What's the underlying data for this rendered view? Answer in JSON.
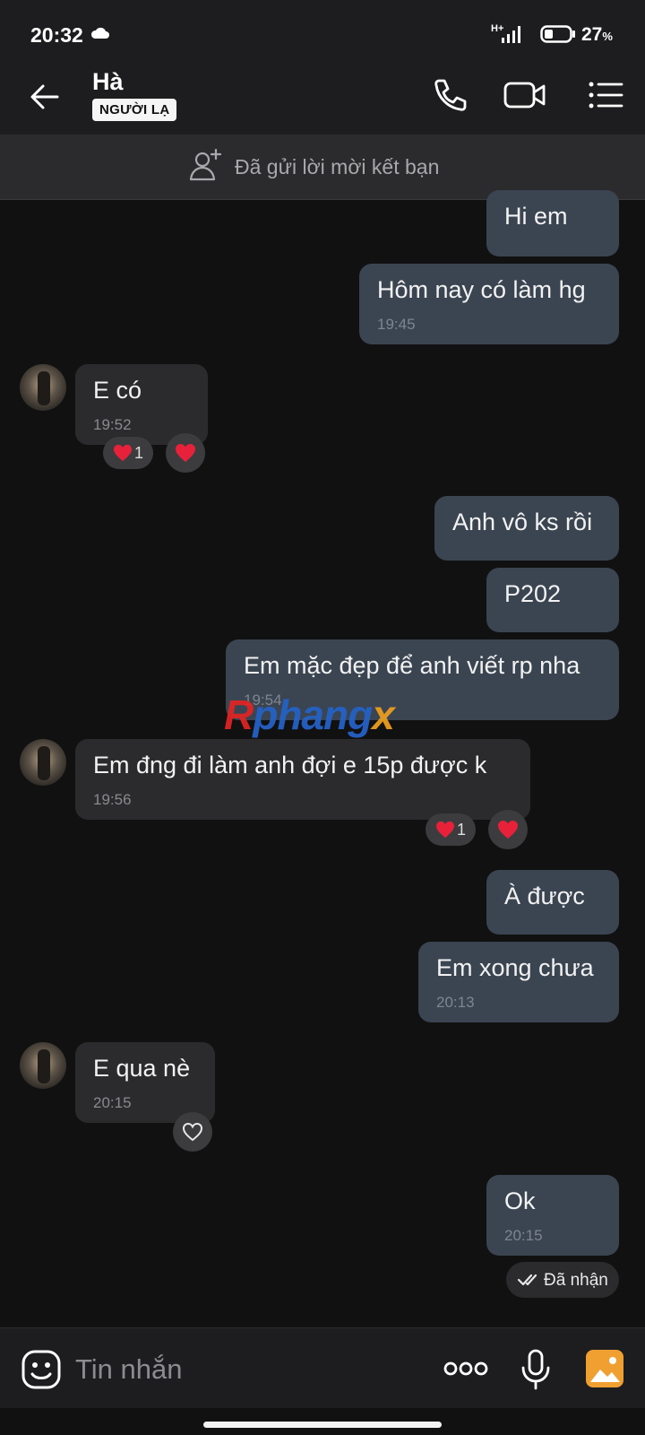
{
  "status": {
    "time": "20:32",
    "network": "H+",
    "battery": "27",
    "battery_unit": "%"
  },
  "header": {
    "name": "Hà",
    "badge": "NGƯỜI LẠ"
  },
  "friend_request": {
    "text": "Đã gửi lời mời kết bạn"
  },
  "messages": [
    {
      "dir": "out",
      "text": "Hi em",
      "time": ""
    },
    {
      "dir": "out",
      "text": "Hôm nay có làm hg",
      "time": "19:45"
    },
    {
      "dir": "in",
      "text": "E có",
      "time": "19:52",
      "reaction_count": "1"
    },
    {
      "dir": "out",
      "text": "Anh vô ks rồi",
      "time": ""
    },
    {
      "dir": "out",
      "text": "P202",
      "time": ""
    },
    {
      "dir": "out",
      "text": "Em mặc đẹp để anh viết rp nha",
      "time": "19:54"
    },
    {
      "dir": "in",
      "text": "Em đng đi làm anh đợi e 15p được k",
      "time": "19:56",
      "reaction_count": "1"
    },
    {
      "dir": "out",
      "text": "À được",
      "time": ""
    },
    {
      "dir": "out",
      "text": "Em xong chưa",
      "time": "20:13"
    },
    {
      "dir": "in",
      "text": "E qua nè",
      "time": "20:15"
    },
    {
      "dir": "out",
      "text": "Ok",
      "time": "20:15"
    }
  ],
  "seen_status": "Đã nhận",
  "watermark": {
    "a": "R",
    "b": "phang",
    "c": "x"
  },
  "input": {
    "placeholder": "Tin nhắn"
  },
  "colors": {
    "outgoing_bubble": "#3a4551",
    "incoming_bubble": "#2b2b2d",
    "background": "#111112",
    "bar": "#1d1d1f"
  },
  "icons": [
    "cloud-icon",
    "signal-icon",
    "battery-icon",
    "back-arrow-icon",
    "phone-icon",
    "video-camera-icon",
    "list-menu-icon",
    "add-user-icon",
    "heart-icon",
    "heart-outline-icon",
    "double-check-icon",
    "sticker-icon",
    "more-dots-icon",
    "microphone-icon",
    "gallery-icon"
  ]
}
